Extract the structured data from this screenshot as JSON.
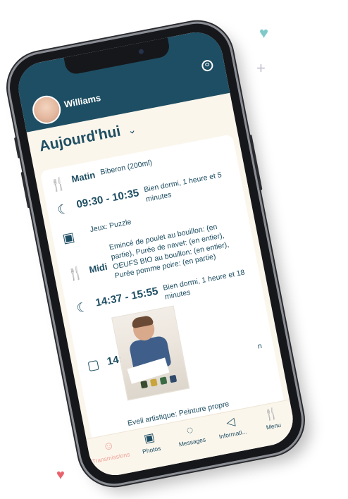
{
  "header": {
    "user_name": "Williams"
  },
  "day": {
    "title": "Aujourd'hui",
    "chevron": "⌄"
  },
  "entries": [
    {
      "icon": "fork-knife-icon",
      "label": "Matin",
      "detail": "Biberon (200ml)"
    },
    {
      "icon": "sleep-icon",
      "time": "09:30 - 10:35",
      "detail": "Bien dormi, 1 heure et 5 minutes"
    },
    {
      "icon": "activity-icon",
      "detail": "Jeux: Puzzle"
    },
    {
      "icon": "fork-knife-icon",
      "label": "Midi",
      "detail": "Emincé de poulet au bouillon: (en partie), Purée de navet: (en entier), OEUFS BIO au bouillon: (en entier), Purée pomme poire: (en partie)"
    },
    {
      "icon": "sleep-icon",
      "time": "14:37 - 15:55",
      "detail": "Bien dormi, 1 heure et 18 minutes"
    },
    {
      "icon": "photo-icon",
      "time": "14:36",
      "detail": "n"
    },
    {
      "icon": "activity-icon",
      "detail": "Eveil artistique: Peinture propre"
    }
  ],
  "nav": [
    {
      "icon": "baby-face-icon",
      "label": "Transmissions",
      "active": true
    },
    {
      "icon": "photo-frame-icon",
      "label": "Photos"
    },
    {
      "icon": "chat-bubble-icon",
      "label": "Messages"
    },
    {
      "icon": "megaphone-icon",
      "label": "Informati..."
    },
    {
      "icon": "fork-knife-icon",
      "label": "Menu"
    }
  ],
  "colors": {
    "header": "#1e4e63",
    "background": "#fbf6ec",
    "active_tab": "#f0a39a"
  }
}
